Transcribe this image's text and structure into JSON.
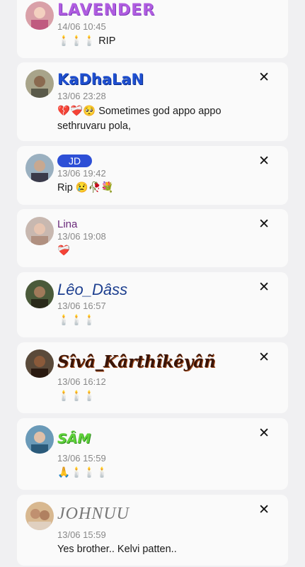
{
  "comments": [
    {
      "name": "LAVENDER",
      "time": "14/06 10:45",
      "message": "🕯️🕯️🕯️ RIP"
    },
    {
      "name": "KaDhaLaN",
      "time": "13/06 23:28",
      "message": "💔❤️‍🩹🥺 Sometimes god appo appo sethruvaru pola,"
    },
    {
      "name": "JD",
      "time": "13/06 19:42",
      "message": "Rip 😢🥀💐"
    },
    {
      "name": "Lina",
      "time": "13/06 19:08",
      "message": "❤️‍🩹"
    },
    {
      "name": "Lêo_Dâss",
      "time": "13/06 16:57",
      "message": "🕯️🕯️🕯️"
    },
    {
      "name": "Sîvâ_Kârthîkêyâñ",
      "time": "13/06 16:12",
      "message": "🕯️🕯️🕯️"
    },
    {
      "name": "SÂM",
      "time": "13/06 15:59",
      "message": "🙏🕯️🕯️🕯️"
    },
    {
      "name": "JOHNUU",
      "time": "13/06 15:59",
      "message": "Yes brother.. Kelvi patten.."
    }
  ],
  "icons": {
    "close": "close-icon",
    "avatar": "avatar"
  },
  "close_glyph": "✕",
  "colors": {
    "background": "#f0f0f2",
    "card": "#fafafa",
    "timestamp": "#888888",
    "jd_badge": "#2d4fd6"
  }
}
